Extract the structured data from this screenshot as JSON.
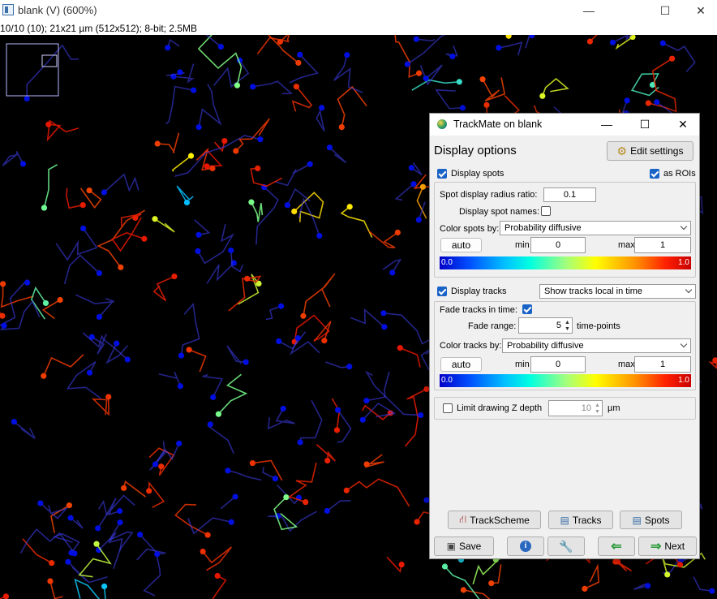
{
  "main_window": {
    "title": "blank (V) (600%)",
    "status": "10/10 (10); 21x21 µm (512x512); 8-bit; 2.5MB",
    "controls": [
      "—",
      "☐",
      "✕"
    ]
  },
  "dialog": {
    "title": "TrackMate on blank",
    "controls": [
      "—",
      "☐",
      "✕"
    ],
    "header": "Display options",
    "edit_settings": "Edit settings",
    "spots": {
      "display_label": "Display spots",
      "display_checked": true,
      "as_rois_label": "as ROIs",
      "as_rois_checked": true,
      "radius_label": "Spot display radius ratio:",
      "radius_value": "0.1",
      "names_label": "Display spot names:",
      "names_checked": false,
      "color_by_label": "Color spots by:",
      "color_by_value": "Probability diffusive",
      "auto_label": "auto",
      "min_label": "min",
      "min_value": "0",
      "max_label": "max",
      "max_value": "1",
      "lut_lo": "0.0",
      "lut_hi": "1.0"
    },
    "tracks": {
      "display_label": "Display tracks",
      "display_checked": true,
      "mode_value": "Show tracks local in time",
      "fade_label": "Fade tracks in time:",
      "fade_checked": true,
      "fade_range_label": "Fade range:",
      "fade_range_value": "5",
      "fade_unit": "time-points",
      "color_by_label": "Color tracks by:",
      "color_by_value": "Probability diffusive",
      "auto_label": "auto",
      "min_label": "min",
      "min_value": "0",
      "max_label": "max",
      "max_value": "1",
      "lut_lo": "0.0",
      "lut_hi": "1.0"
    },
    "zdepth": {
      "label": "Limit drawing Z depth",
      "checked": false,
      "value": "10",
      "unit": "µm"
    },
    "buttons": {
      "trackscheme": "TrackScheme",
      "tracks": "Tracks",
      "spots": "Spots",
      "save": "Save",
      "next": "Next"
    }
  }
}
